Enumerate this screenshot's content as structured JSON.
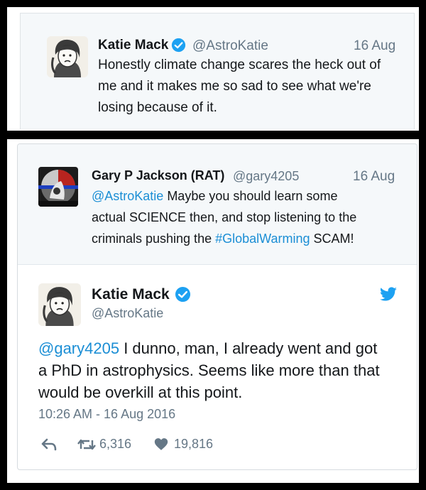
{
  "top_tweet": {
    "name": "Katie Mack",
    "handle": "@AstroKatie",
    "date": "16 Aug",
    "text_lines": [
      "Honestly climate change scares the heck out of",
      "me and it makes me so sad to see what we're",
      "losing because of it."
    ]
  },
  "reply_tweet": {
    "name": "Gary P Jackson (RAT)",
    "handle": "@gary4205",
    "date": "16 Aug",
    "mention": "@AstroKatie",
    "line1_rest": " Maybe you should learn some",
    "line2": "actual SCIENCE then, and stop listening to the",
    "line3_pre": "criminals pushing the ",
    "hashtag": "#GlobalWarming",
    "line3_post": " SCAM!"
  },
  "main_tweet": {
    "name": "Katie Mack",
    "handle": "@AstroKatie",
    "mention": "@gary4205",
    "line1_rest": " I dunno, man, I already went and got",
    "line2": "a PhD in astrophysics. Seems like more than that",
    "line3": "would be overkill at this point.",
    "timestamp": "10:26 AM - 16 Aug 2016",
    "retweets": "6,316",
    "likes": "19,816"
  },
  "icons": {
    "verified": "verified-badge-icon",
    "twitter": "twitter-bird-icon",
    "reply": "reply-icon",
    "retweet": "retweet-icon",
    "like": "heart-icon"
  },
  "colors": {
    "link": "#1b8ed5",
    "verified": "#1da1f2",
    "muted": "#657786",
    "card_bg": "#f5f8fa"
  }
}
